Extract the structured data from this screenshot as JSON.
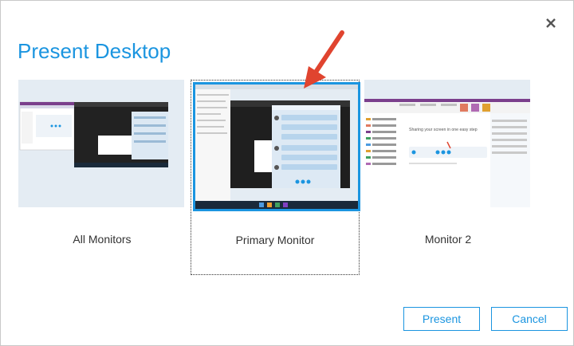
{
  "dialog": {
    "title": "Present Desktop",
    "close_icon": "close-icon"
  },
  "options": [
    {
      "label": "All Monitors",
      "selected": false
    },
    {
      "label": "Primary Monitor",
      "selected": true
    },
    {
      "label": "Monitor 2",
      "selected": false
    }
  ],
  "thumbnails": {
    "monitor2": {
      "heading": "Sharing your screen in one easy step"
    }
  },
  "buttons": {
    "present_label": "Present",
    "cancel_label": "Cancel"
  },
  "colors": {
    "accent": "#1b95e0",
    "arrow": "#e0442f"
  }
}
